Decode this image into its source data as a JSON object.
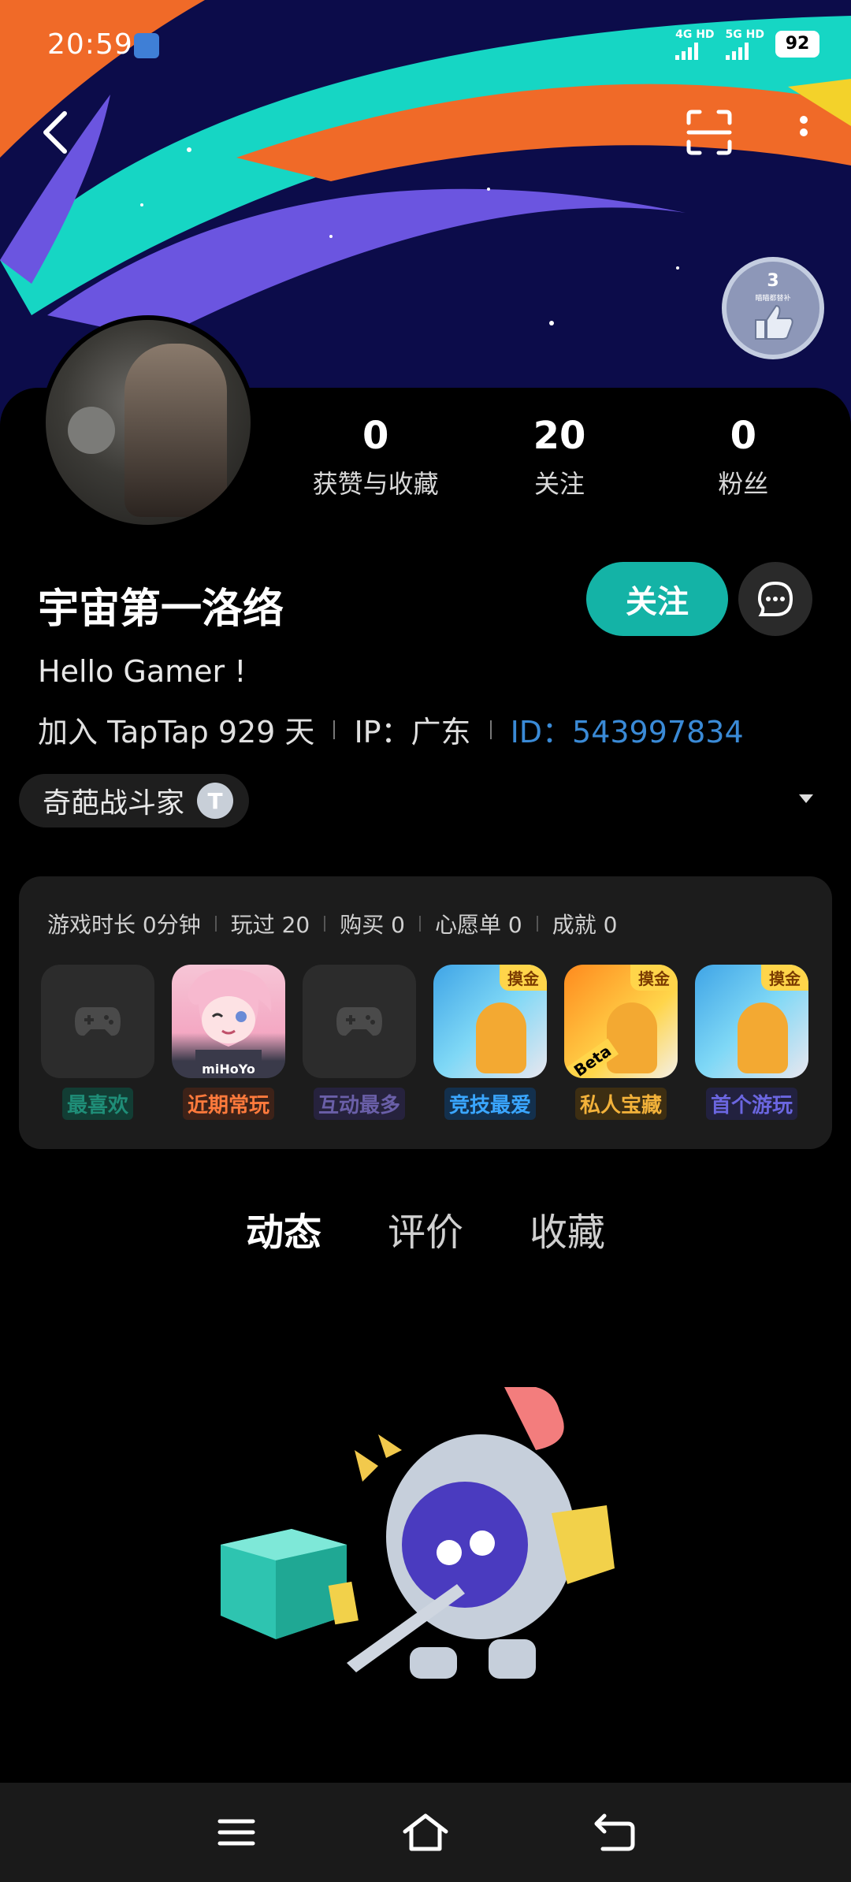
{
  "status_bar": {
    "time": "20:59",
    "network_1": "4G HD",
    "network_2": "5G HD",
    "battery": "92"
  },
  "profile": {
    "stats": [
      {
        "value": "0",
        "label": "获赞与收藏"
      },
      {
        "value": "20",
        "label": "关注"
      },
      {
        "value": "0",
        "label": "粉丝"
      }
    ],
    "username": "宇宙第一洛络",
    "follow_label": "关注",
    "bio": "Hello Gamer !",
    "joined": "加入 TapTap 929 天",
    "ip": "IP：广东",
    "id": "ID：543997834",
    "badge_level": "3",
    "badge_caption": "瞄瞄都替补",
    "tag": "奇葩战斗家",
    "tag_icon": "T"
  },
  "game_card": {
    "stats": [
      "游戏时长 0分钟",
      "玩过 20",
      "购买 0",
      "心愿单 0",
      "成就 0"
    ],
    "games": [
      {
        "label": "最喜欢",
        "color": "#1f8e78",
        "bg": "#123d34",
        "icon": "gamepad-icon"
      },
      {
        "label": "近期常玩",
        "color": "#ff7a3c",
        "bg": "#3d2218",
        "icon": "anime-game-icon",
        "brand": "miHoYo"
      },
      {
        "label": "互动最多",
        "color": "#6a5fa8",
        "bg": "#26223d",
        "icon": "gamepad-icon"
      },
      {
        "label": "竞技最爱",
        "color": "#3aa6ff",
        "bg": "#13304d",
        "icon": "duel-game-icon",
        "corner": "摸金"
      },
      {
        "label": "私人宝藏",
        "color": "#f3b23a",
        "bg": "#3d2e12",
        "icon": "duel-game-icon",
        "corner": "摸金",
        "beta": "Beta"
      },
      {
        "label": "首个游玩",
        "color": "#6b66e0",
        "bg": "#22213f",
        "icon": "duel-game-icon",
        "corner": "摸金"
      }
    ]
  },
  "tabs": [
    "动态",
    "评价",
    "收藏"
  ],
  "colors": {
    "accent": "#14b3a6",
    "id_link": "#3a8ad6",
    "banner_bg": "#0c0c4a"
  }
}
